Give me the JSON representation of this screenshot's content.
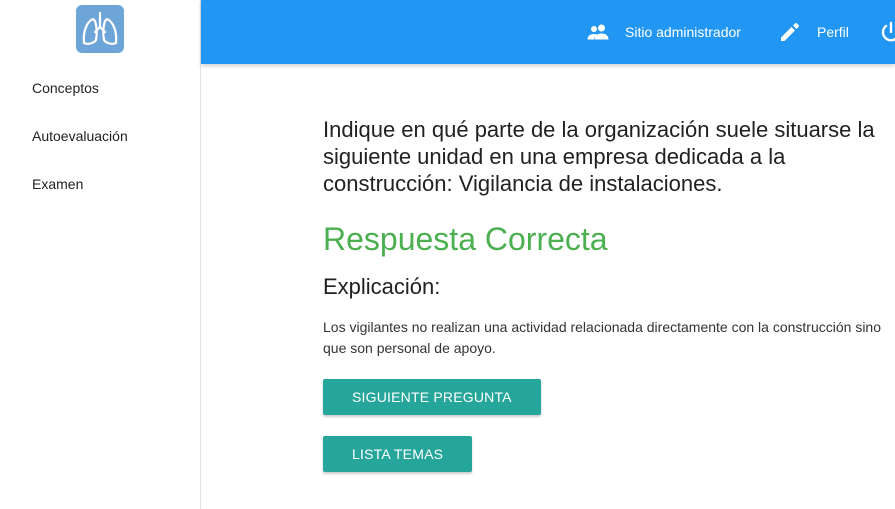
{
  "sidebar": {
    "logo_icon": "lungs-icon",
    "items": [
      {
        "label": "Conceptos"
      },
      {
        "label": "Autoevaluación"
      },
      {
        "label": "Examen"
      }
    ]
  },
  "topbar": {
    "color": "#2196f3",
    "admin": {
      "label": "Sitio administrador",
      "icon": "people-icon"
    },
    "profile": {
      "label": "Perfil",
      "icon": "pencil-icon"
    },
    "logout": {
      "icon": "power-icon"
    }
  },
  "main": {
    "question": "Indique en qué parte de la organización suele situarse la siguiente unidad en una empresa dedicada a la construcción: Vigilancia de instalaciones.",
    "result": "Respuesta Correcta",
    "result_color": "#4caf50",
    "explanation_title": "Explicación:",
    "explanation_text": "Los vigilantes no realizan una actividad relacionada directamente con la construcción sino que son personal de apoyo.",
    "next_button": "Siguiente pregunta",
    "topics_button": "Lista temas",
    "button_color": "#26a69a"
  }
}
